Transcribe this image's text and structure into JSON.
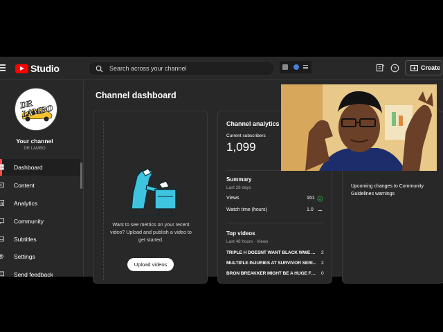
{
  "header": {
    "logo_text": "Studio",
    "search_placeholder": "Search across your channel",
    "create_label": "Create"
  },
  "sidebar": {
    "avatar_text": "DR LAMBO",
    "channel_title": "Your channel",
    "channel_name": "DR LAMBO",
    "items": [
      {
        "label": "Dashboard",
        "icon": "dashboard-icon",
        "active": true
      },
      {
        "label": "Content",
        "icon": "content-icon"
      },
      {
        "label": "Analytics",
        "icon": "analytics-icon"
      },
      {
        "label": "Community",
        "icon": "community-icon"
      },
      {
        "label": "Subtitles",
        "icon": "subtitles-icon"
      },
      {
        "label": "Settings",
        "icon": "gear-icon"
      },
      {
        "label": "Send feedback",
        "icon": "feedback-icon"
      }
    ]
  },
  "main": {
    "title": "Channel dashboard",
    "upload_card": {
      "text": "Want to see metrics on your recent video? Upload and publish a video to get started.",
      "button_label": "Upload videos"
    },
    "analytics": {
      "title": "Channel analytics",
      "subscribers_label": "Current subscribers",
      "subscribers_value": "1,099",
      "summary_title": "Summary",
      "summary_period": "Last 28 days",
      "rows": [
        {
          "label": "Views",
          "value": "161",
          "status": "check"
        },
        {
          "label": "Watch time (hours)",
          "value": "1.0",
          "status": "dash"
        }
      ],
      "top_videos_title": "Top videos",
      "top_videos_period": "Last 48 hours · Views",
      "top_videos": [
        {
          "title": "TRIPLE H DOESNT WANT BLACK WWE ...",
          "views": "2"
        },
        {
          "title": "MULTIPLE INJURIES AT SURVIVOR SERI...",
          "views": "2"
        },
        {
          "title": "BRON BREAKKER MIGHT BE A HUGE FO...",
          "views": "0"
        }
      ]
    },
    "news": {
      "text": "Upcoming changes to Community Guidelines warnings"
    }
  },
  "colors": {
    "background": "#282828",
    "brand_red": "#ff0000",
    "active_indicator": "#ff4e45",
    "check_green": "#2ba640"
  }
}
